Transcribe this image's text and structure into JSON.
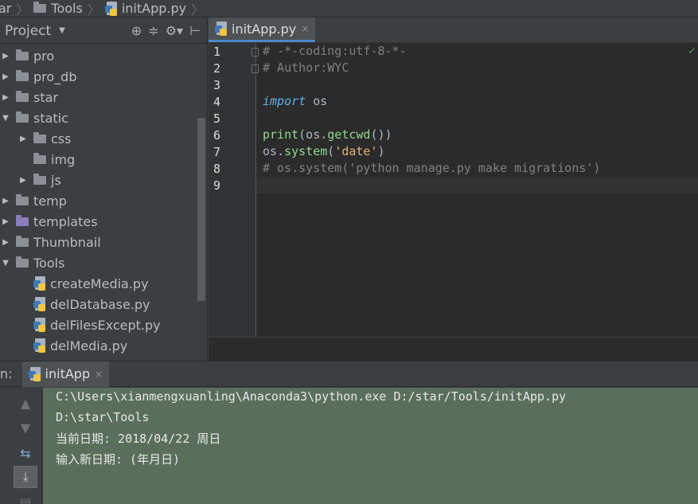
{
  "breadcrumb": [
    {
      "label": "ar",
      "icon": "none"
    },
    {
      "label": "Tools",
      "icon": "folder-icon"
    },
    {
      "label": "initApp.py",
      "icon": "python-file-icon"
    }
  ],
  "project_panel": {
    "title": "Project",
    "header_icons": [
      "target-icon",
      "collapse-icon",
      "gear-icon",
      "hide-icon"
    ],
    "tree": [
      {
        "label": "pro",
        "type": "folder",
        "expanded": false,
        "depth": 0
      },
      {
        "label": "pro_db",
        "type": "folder",
        "expanded": false,
        "depth": 0
      },
      {
        "label": "star",
        "type": "folder",
        "expanded": false,
        "depth": 0
      },
      {
        "label": "static",
        "type": "folder",
        "expanded": true,
        "depth": 0
      },
      {
        "label": "css",
        "type": "folder",
        "expanded": false,
        "depth": 1
      },
      {
        "label": "img",
        "type": "folder",
        "expanded": null,
        "depth": 1
      },
      {
        "label": "js",
        "type": "folder",
        "expanded": false,
        "depth": 1
      },
      {
        "label": "temp",
        "type": "folder",
        "expanded": false,
        "depth": 0
      },
      {
        "label": "templates",
        "type": "template-folder",
        "expanded": false,
        "depth": 0
      },
      {
        "label": "Thumbnail",
        "type": "folder",
        "expanded": false,
        "depth": 0
      },
      {
        "label": "Tools",
        "type": "folder",
        "expanded": true,
        "depth": 0
      },
      {
        "label": "createMedia.py",
        "type": "python",
        "depth": 1
      },
      {
        "label": "delDatabase.py",
        "type": "python",
        "depth": 1
      },
      {
        "label": "delFilesExcept.py",
        "type": "python",
        "depth": 1
      },
      {
        "label": "delMedia.py",
        "type": "python",
        "depth": 1
      }
    ]
  },
  "editor": {
    "tab_label": "initApp.py",
    "tab_close": "×",
    "line_numbers": [
      "1",
      "2",
      "3",
      "4",
      "5",
      "6",
      "7",
      "8",
      "9"
    ],
    "lines": [
      [
        {
          "t": "# -*-coding:utf-8-*-",
          "c": "comment"
        }
      ],
      [
        {
          "t": "# Author:WYC",
          "c": "comment"
        }
      ],
      [],
      [
        {
          "t": "import",
          "c": "kw"
        },
        {
          "t": " os",
          "c": "def"
        }
      ],
      [],
      [
        {
          "t": "print",
          "c": "fn"
        },
        {
          "t": "(os.",
          "c": "def"
        },
        {
          "t": "getcwd",
          "c": "fn"
        },
        {
          "t": "())",
          "c": "def"
        }
      ],
      [
        {
          "t": "os.",
          "c": "def"
        },
        {
          "t": "system",
          "c": "fn"
        },
        {
          "t": "(",
          "c": "def"
        },
        {
          "t": "'date'",
          "c": "str"
        },
        {
          "t": ")",
          "c": "def"
        }
      ],
      [
        {
          "t": "# os.system('python manage.py make migrations')",
          "c": "comment"
        }
      ],
      []
    ],
    "current_line": 9,
    "status_mark": "✓"
  },
  "run_panel": {
    "label": "n:",
    "tab_label": "initApp",
    "tab_close": "×",
    "toolbar_icons": [
      "arrow-up-icon",
      "arrow-down-icon",
      "soft-wrap-icon",
      "scroll-to-end-icon",
      "print-icon"
    ],
    "console": [
      "C:\\Users\\xianmengxuanling\\Anaconda3\\python.exe D:/star/Tools/initApp.py",
      "D:\\star\\Tools",
      "当前日期: 2018/04/22 周日",
      "输入新日期: (年月日)"
    ]
  },
  "colors": {
    "ide_background": "#3c3f41",
    "editor_background": "#2b2b2b",
    "console_background": "#5a6e5c",
    "keyword": "#5bb3e6",
    "function": "#8fd88d",
    "string": "#e6b36a",
    "comment": "#808080"
  }
}
